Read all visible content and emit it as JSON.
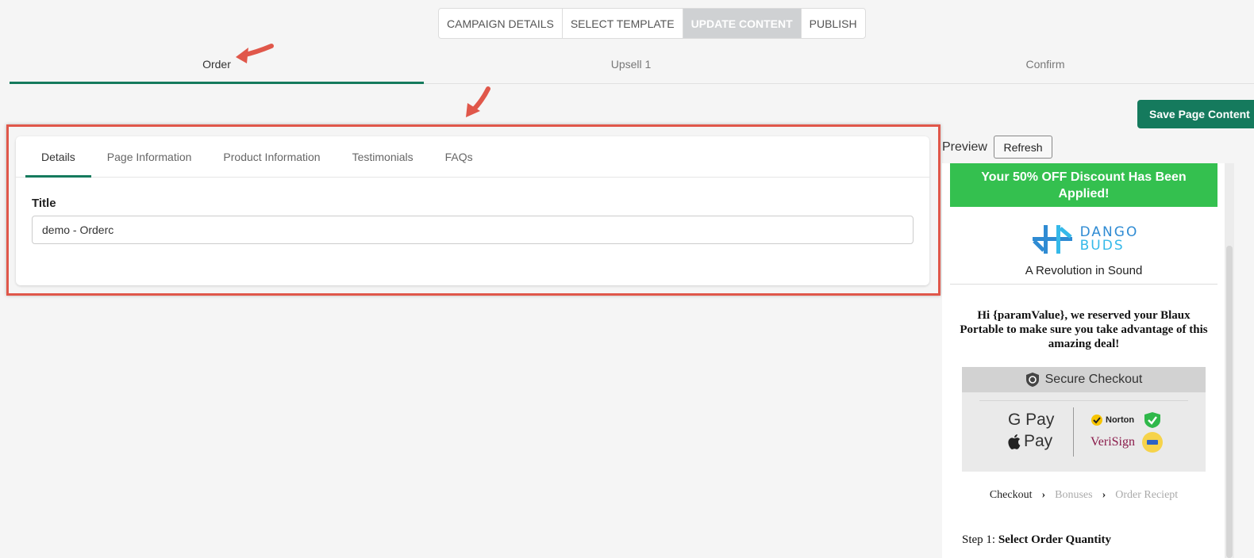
{
  "wizard": {
    "steps": [
      {
        "label": "CAMPAIGN DETAILS"
      },
      {
        "label": "SELECT TEMPLATE"
      },
      {
        "label": "UPDATE CONTENT"
      },
      {
        "label": "PUBLISH"
      }
    ],
    "active": "UPDATE CONTENT"
  },
  "page_tabs": [
    {
      "label": "Order"
    },
    {
      "label": "Upsell 1"
    },
    {
      "label": "Confirm"
    }
  ],
  "editor": {
    "tabs": [
      {
        "label": "Details"
      },
      {
        "label": "Page Information"
      },
      {
        "label": "Product Information"
      },
      {
        "label": "Testimonials"
      },
      {
        "label": "FAQs"
      }
    ],
    "title_label": "Title",
    "title_value": "demo - Orderc"
  },
  "actions": {
    "save_label": "Save Page Content",
    "preview_label": "Preview",
    "refresh_label": "Refresh"
  },
  "preview": {
    "discount_banner": "Your 50% OFF Discount Has Been Applied!",
    "logo_line1": "DANGO",
    "logo_line2": "BUDS",
    "tagline": "A Revolution in Sound",
    "greeting": "Hi {paramValue}, we reserved your Blaux Portable to make sure you take advantage of this amazing deal!",
    "secure_checkout": "Secure Checkout",
    "gpay": "G Pay",
    "applepay": "Pay",
    "norton": "Norton",
    "verisign": "VeriSign",
    "checkout_steps": [
      "Checkout",
      "Bonuses",
      "Order Reciept"
    ],
    "step1_prefix": "Step 1:",
    "step1_title": "Select Order Quantity"
  },
  "colors": {
    "accent": "#157a5d",
    "highlight": "#e0574a",
    "discount_green": "#34c04f",
    "active_step_bg": "#cfd1d3"
  }
}
